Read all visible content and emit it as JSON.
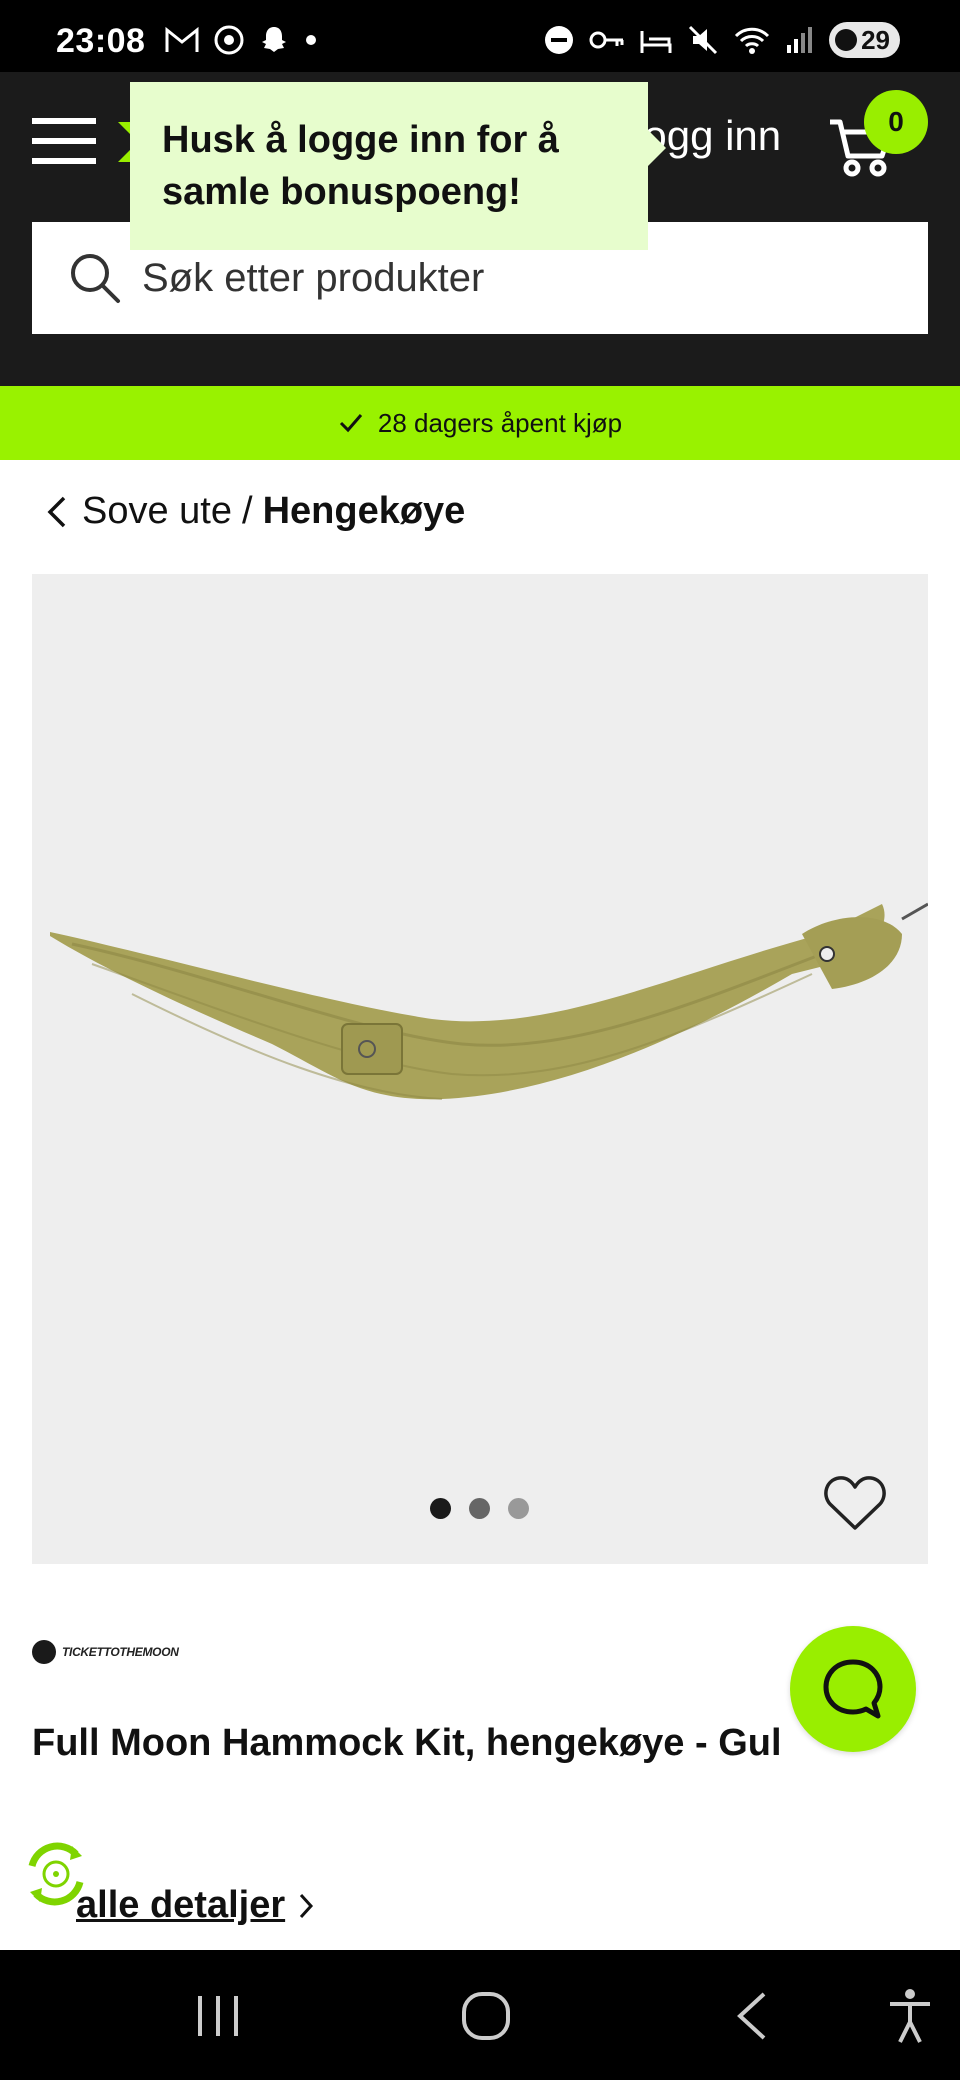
{
  "status_bar": {
    "time": "23:08",
    "battery": "29",
    "left_icons": [
      "gmail-icon",
      "shazam-icon",
      "snapchat-icon",
      "dot-icon"
    ],
    "right_icons": [
      "dnd-icon",
      "key-icon",
      "sleep-icon",
      "mute-icon",
      "wifi-icon",
      "signal-icon"
    ]
  },
  "header": {
    "login_label": "Logg inn",
    "cart_count": "0",
    "search_placeholder": "Søk etter produkter"
  },
  "tooltip": {
    "text": "Husk å logge inn for å samle bonuspoeng!"
  },
  "banner": {
    "text": "28 dagers åpent kjøp"
  },
  "breadcrumb": {
    "parent": "Sove ute",
    "separator": "/",
    "current": "Hengekøye"
  },
  "gallery": {
    "image_count": 3,
    "active_index": 0
  },
  "product": {
    "brand": "TICKETTOTHEMOON",
    "title": "Full Moon Hammock Kit, hengekøye - Gul",
    "details_link": "alle detaljer"
  },
  "colors": {
    "brand_green": "#99f200",
    "header_bg": "#1b1b1b",
    "tooltip_bg": "#e7fdcd",
    "image_bg": "#eeeeee"
  }
}
